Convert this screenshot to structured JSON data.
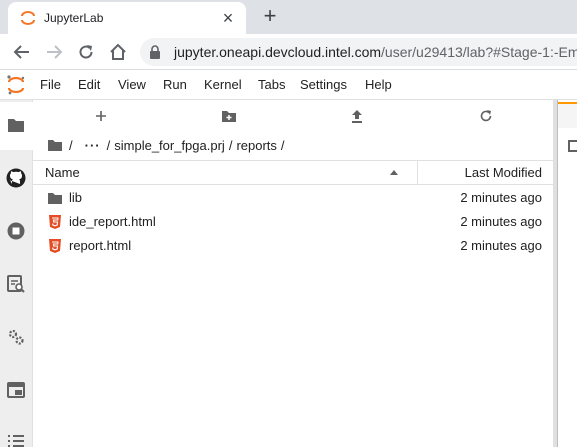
{
  "browser": {
    "tab_title": "JupyterLab",
    "url_host": "jupyter.oneapi.devcloud.intel.com",
    "url_path": "/user/u29413/lab?#Stage-1:-Em"
  },
  "menu": {
    "items": [
      "File",
      "Edit",
      "View",
      "Run",
      "Kernel",
      "Tabs",
      "Settings",
      "Help"
    ]
  },
  "breadcrumbs": {
    "ellipsis": "···",
    "sep": "/",
    "parts": [
      "simple_for_fpga.prj",
      "reports"
    ]
  },
  "listing": {
    "columns": {
      "name": "Name",
      "modified": "Last Modified"
    },
    "rows": [
      {
        "name": "lib",
        "modified": "2 minutes ago",
        "icon": "folder-icon"
      },
      {
        "name": "ide_report.html",
        "modified": "2 minutes ago",
        "icon": "html5-icon"
      },
      {
        "name": "report.html",
        "modified": "2 minutes ago",
        "icon": "html5-icon"
      }
    ]
  },
  "colors": {
    "jupyter_orange": "#f37626",
    "html_icon": "#e44d26",
    "icon_gray": "#616161"
  }
}
